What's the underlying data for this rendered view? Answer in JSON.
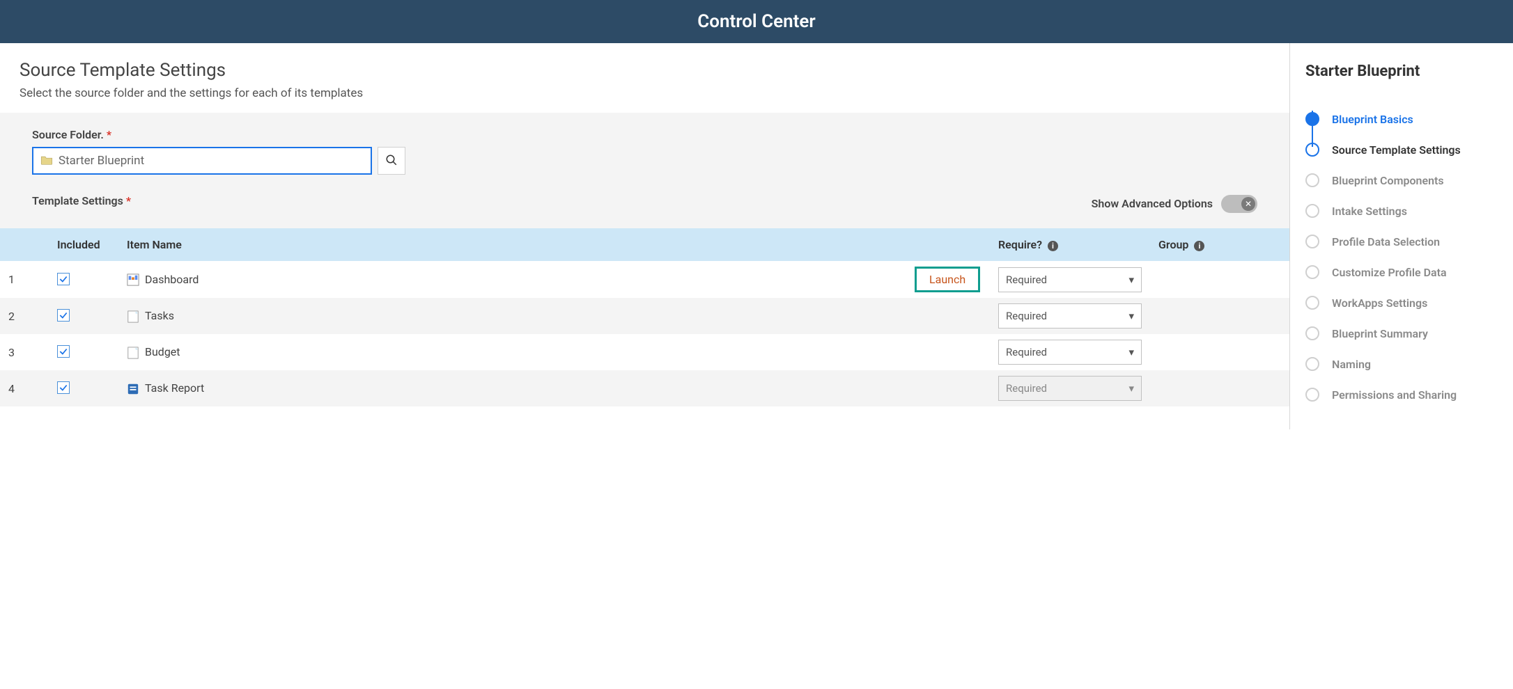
{
  "appTitle": "Control Center",
  "page": {
    "title": "Source Template Settings",
    "subtitle": "Select the source folder and the settings for each of its templates"
  },
  "sourceFolder": {
    "label": "Source Folder.",
    "value": "Starter Blueprint"
  },
  "templateSettings": {
    "label": "Template Settings",
    "advancedLabel": "Show Advanced Options"
  },
  "table": {
    "headers": {
      "included": "Included",
      "itemName": "Item Name",
      "require": "Require?",
      "group": "Group"
    },
    "rows": [
      {
        "num": "1",
        "name": "Dashboard",
        "launch": "Launch",
        "require": "Required",
        "disabled": false,
        "icon": "dashboard"
      },
      {
        "num": "2",
        "name": "Tasks",
        "launch": "",
        "require": "Required",
        "disabled": false,
        "icon": "sheet"
      },
      {
        "num": "3",
        "name": "Budget",
        "launch": "",
        "require": "Required",
        "disabled": false,
        "icon": "sheet"
      },
      {
        "num": "4",
        "name": "Task Report",
        "launch": "",
        "require": "Required",
        "disabled": true,
        "icon": "report"
      }
    ]
  },
  "sidebar": {
    "title": "Starter Blueprint",
    "steps": [
      {
        "label": "Blueprint Basics",
        "state": "done"
      },
      {
        "label": "Source Template Settings",
        "state": "active"
      },
      {
        "label": "Blueprint Components",
        "state": "pending"
      },
      {
        "label": "Intake Settings",
        "state": "pending"
      },
      {
        "label": "Profile Data Selection",
        "state": "pending"
      },
      {
        "label": "Customize Profile Data",
        "state": "pending"
      },
      {
        "label": "WorkApps Settings",
        "state": "pending"
      },
      {
        "label": "Blueprint Summary",
        "state": "pending"
      },
      {
        "label": "Naming",
        "state": "pending"
      },
      {
        "label": "Permissions and Sharing",
        "state": "pending"
      }
    ]
  }
}
